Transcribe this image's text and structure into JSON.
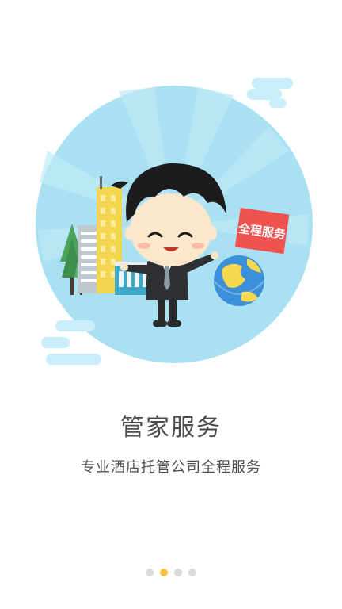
{
  "hero": {
    "badge_text": "全程服务"
  },
  "content": {
    "title": "管家服务",
    "subtitle": "专业酒店托管公司全程服务"
  },
  "pager": {
    "count": 4,
    "active_index": 1
  },
  "colors": {
    "sky": "#a9e1f2",
    "cloud": "#c9eefa",
    "badge": "#ef5350",
    "dot_active": "#f5c542",
    "dot_inactive": "#d9d9d9",
    "title": "#4a4a4a"
  }
}
